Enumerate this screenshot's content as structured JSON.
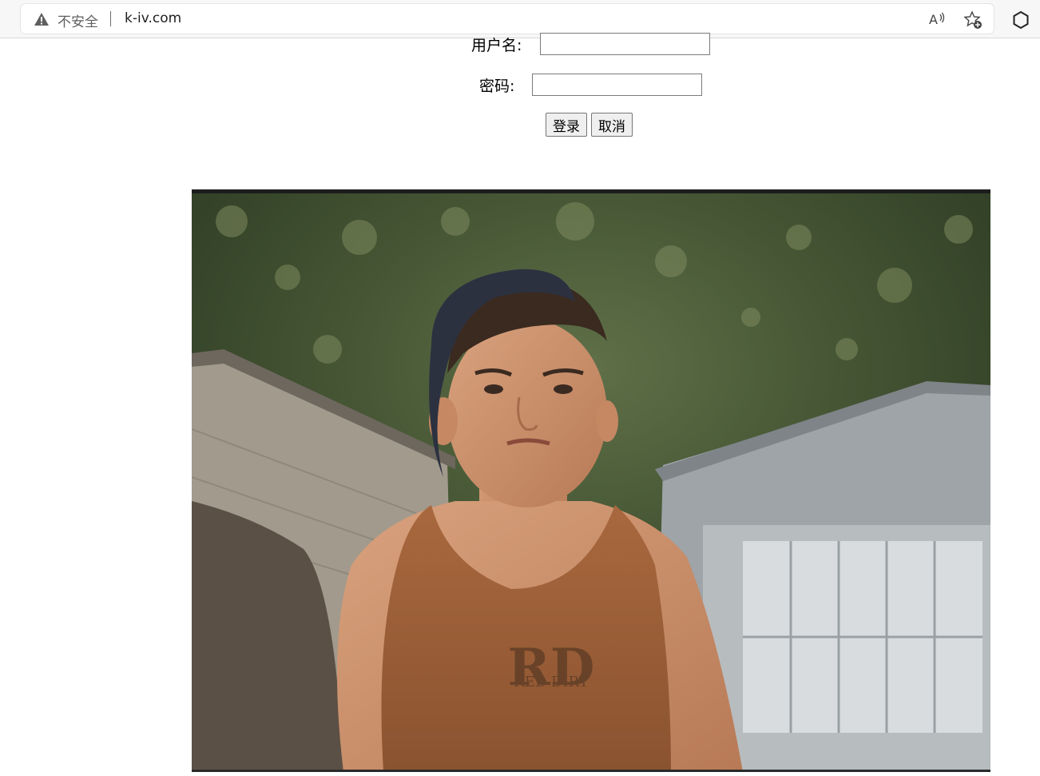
{
  "browser": {
    "security_label": "不安全",
    "url": "k-iv.com",
    "icons": [
      "warning-icon",
      "read-aloud-icon",
      "add-favorite-icon",
      "extensions-icon"
    ]
  },
  "login_form": {
    "username_label": "用户名:",
    "username_value": "",
    "password_label": "密码:",
    "password_value": "",
    "login_button": "登录",
    "cancel_button": "取消"
  },
  "photo": {
    "shirt_logo_text": "RED DIRT"
  },
  "colors": {
    "page_background": "#ffffff",
    "button_background": "#efefef",
    "chrome_background": "#f7f7f7"
  }
}
